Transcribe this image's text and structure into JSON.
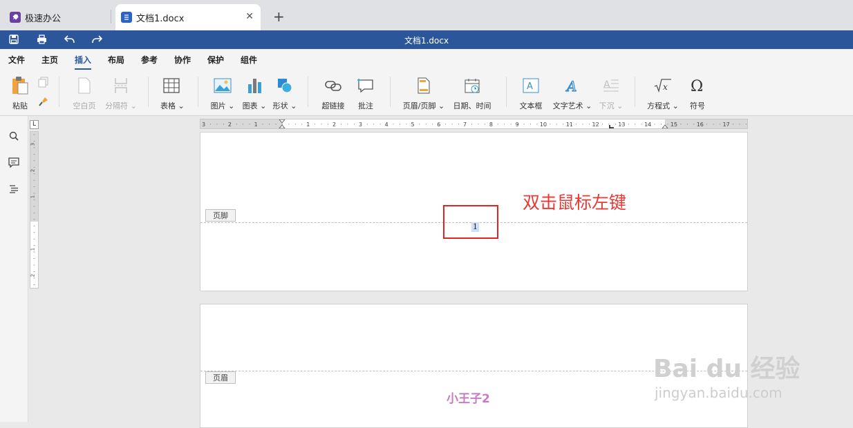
{
  "tabs": [
    {
      "label": "极速办公",
      "icon": "rocket-icon",
      "active": false
    },
    {
      "label": "文档1.docx",
      "icon": "document-icon",
      "active": true
    }
  ],
  "window_title": "文档1.docx",
  "menu": [
    "文件",
    "主页",
    "插入",
    "布局",
    "参考",
    "协作",
    "保护",
    "组件"
  ],
  "active_menu": "插入",
  "ribbon": {
    "paste": "粘贴",
    "blank_page": "空白页",
    "page_break": "分隔符",
    "table": "表格",
    "image": "图片",
    "chart": "图表",
    "shape": "形状",
    "hyperlink": "超链接",
    "comment": "批注",
    "header_footer": "页眉/页脚",
    "date_time": "日期、时间",
    "text_box": "文本框",
    "text_art": "文字艺术",
    "drop_cap": "下沉",
    "equation": "方程式",
    "symbol": "符号"
  },
  "ruler": {
    "h_ticks": [
      "3",
      "2",
      "1",
      "1",
      "2",
      "3",
      "4",
      "5",
      "6",
      "7",
      "8",
      "9",
      "10",
      "11",
      "12",
      "13",
      "14",
      "15",
      "16",
      "17"
    ],
    "v_ticks": [
      "3",
      "2",
      "1",
      "1",
      "2"
    ]
  },
  "page1": {
    "footer_tag": "页脚",
    "page_number": "1"
  },
  "page2": {
    "header_tag": "页眉",
    "header_text": "小王子2"
  },
  "annotation": "双击鼠标左键",
  "watermark": {
    "logo": "Bai du 经验",
    "url": "jingyan.baidu.com"
  },
  "colors": {
    "brand": "#2b579a",
    "annotation": "#e83a33",
    "header_text": "#c97ac0"
  }
}
